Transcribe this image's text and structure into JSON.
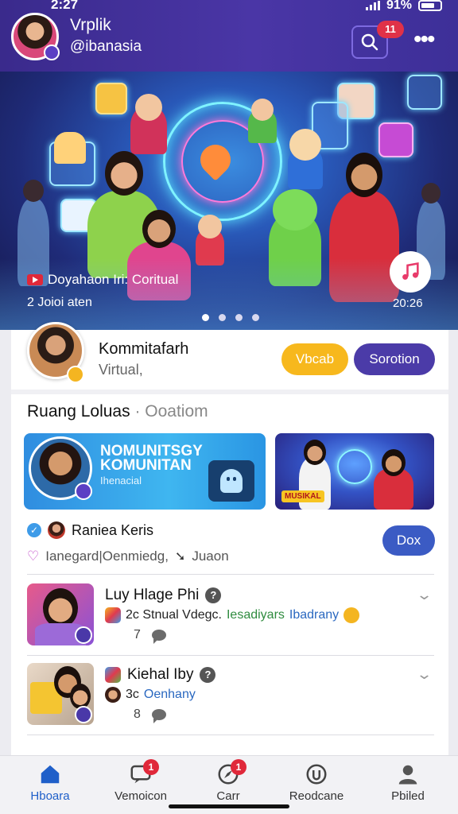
{
  "status_bar": {
    "time": "2:27",
    "battery": "91%"
  },
  "header": {
    "profile_name": "Vrplik",
    "profile_handle": "@ibanasia",
    "notification_count": "11",
    "more_label": "•••"
  },
  "banner": {
    "title": "Doyahaon Iri: Coritual",
    "subtitle": "2 Joioi aten",
    "year": "20:26",
    "slide_count": 4,
    "active_slide": 0
  },
  "community": {
    "name": "Kommitafarh",
    "type": "Virtual,",
    "primary_button": "Vbcab",
    "secondary_button": "Sorotion"
  },
  "section": {
    "title": "Ruang Loluas",
    "title_extra": "· Ooatiom",
    "featured_line1": "NOMUNITSGY",
    "featured_line2": "KOMUNITAN",
    "featured_caption": "Ihenacial",
    "small_tag": "MUSIKAL"
  },
  "post": {
    "author": "Raniea Keris",
    "meta": "Ianegard|Oenmiedg,",
    "meta_extra": "Juaon",
    "action_button": "Dox"
  },
  "list_items": [
    {
      "title": "Luy Hlage Phi",
      "sub": "2c Stnual Vdegc.",
      "sub_green": "Iesadiyars",
      "sub_blue": "Ibadrany",
      "count": "7"
    },
    {
      "title": "Kiehal Iby",
      "sub": "3c",
      "sub_blue": "Oenhany",
      "count": "8"
    }
  ],
  "bottom_nav": [
    {
      "label": "Hboara",
      "icon": "home-icon",
      "active": true
    },
    {
      "label": "Vemoicon",
      "icon": "chat-icon",
      "badge": "1"
    },
    {
      "label": "Carr",
      "icon": "explore-icon",
      "badge": "1"
    },
    {
      "label": "Reodcane",
      "icon": "shield-icon"
    },
    {
      "label": "Pbiled",
      "icon": "profile-icon"
    }
  ],
  "colors": {
    "header_bg": "#3d2f98",
    "accent_yellow": "#f7b81d",
    "accent_purple": "#4b3ba8",
    "accent_blue": "#3b5bc4",
    "badge_red": "#e03148",
    "nav_active": "#1f5fc9"
  }
}
